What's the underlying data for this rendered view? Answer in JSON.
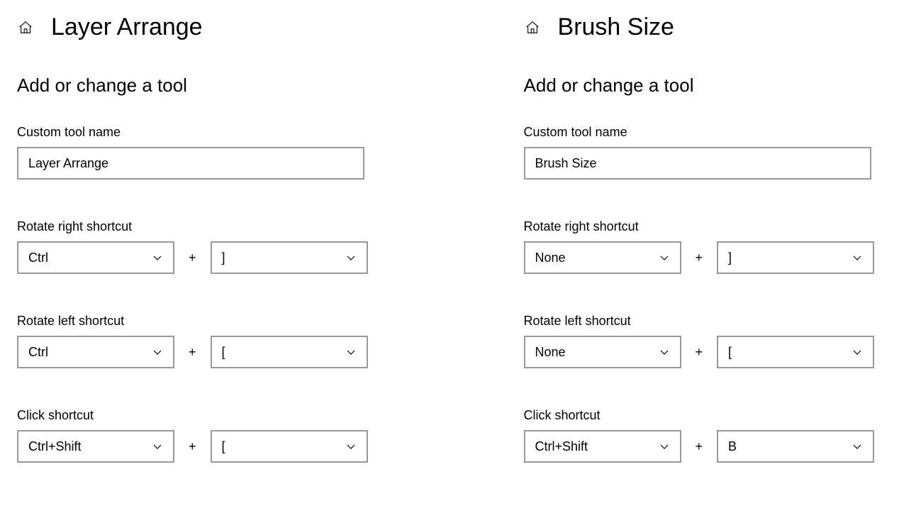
{
  "panels": [
    {
      "title": "Layer Arrange",
      "section_title": "Add or change a tool",
      "tool_name_label": "Custom tool name",
      "tool_name_value": "Layer Arrange",
      "rotate_right_label": "Rotate right shortcut",
      "rotate_right_mod": "Ctrl",
      "rotate_right_key": "]",
      "rotate_left_label": "Rotate left shortcut",
      "rotate_left_mod": "Ctrl",
      "rotate_left_key": "[",
      "click_label": "Click shortcut",
      "click_mod": "Ctrl+Shift",
      "click_key": "[",
      "plus": "+"
    },
    {
      "title": "Brush Size",
      "section_title": "Add or change a tool",
      "tool_name_label": "Custom tool name",
      "tool_name_value": "Brush Size",
      "rotate_right_label": "Rotate right shortcut",
      "rotate_right_mod": "None",
      "rotate_right_key": "]",
      "rotate_left_label": "Rotate left shortcut",
      "rotate_left_mod": "None",
      "rotate_left_key": "[",
      "click_label": "Click shortcut",
      "click_mod": "Ctrl+Shift",
      "click_key": "B",
      "plus": "+"
    }
  ]
}
